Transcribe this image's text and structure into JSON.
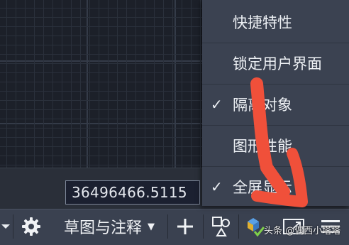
{
  "coordinate_readout": "36496466.5115",
  "status_bar": {
    "workspace_label": "草图与注释",
    "workspace_dropdown": "▼"
  },
  "context_menu": {
    "items": [
      {
        "label": "快捷特性",
        "checked": false,
        "check": ""
      },
      {
        "label": "锁定用户界面",
        "checked": false,
        "check": ""
      },
      {
        "label": "隔离对象",
        "checked": true,
        "check": "✓"
      },
      {
        "label": "图形性能",
        "checked": false,
        "check": ""
      },
      {
        "label": "全屏显示",
        "checked": true,
        "check": "✓"
      }
    ]
  },
  "watermark": "头条 @偶西小塔塔",
  "colors": {
    "canvas_bg": "#1c2029",
    "menu_bg": "#3b4251",
    "status_bar_bg": "#3a4150",
    "annotation_arrow": "#f0503a"
  }
}
